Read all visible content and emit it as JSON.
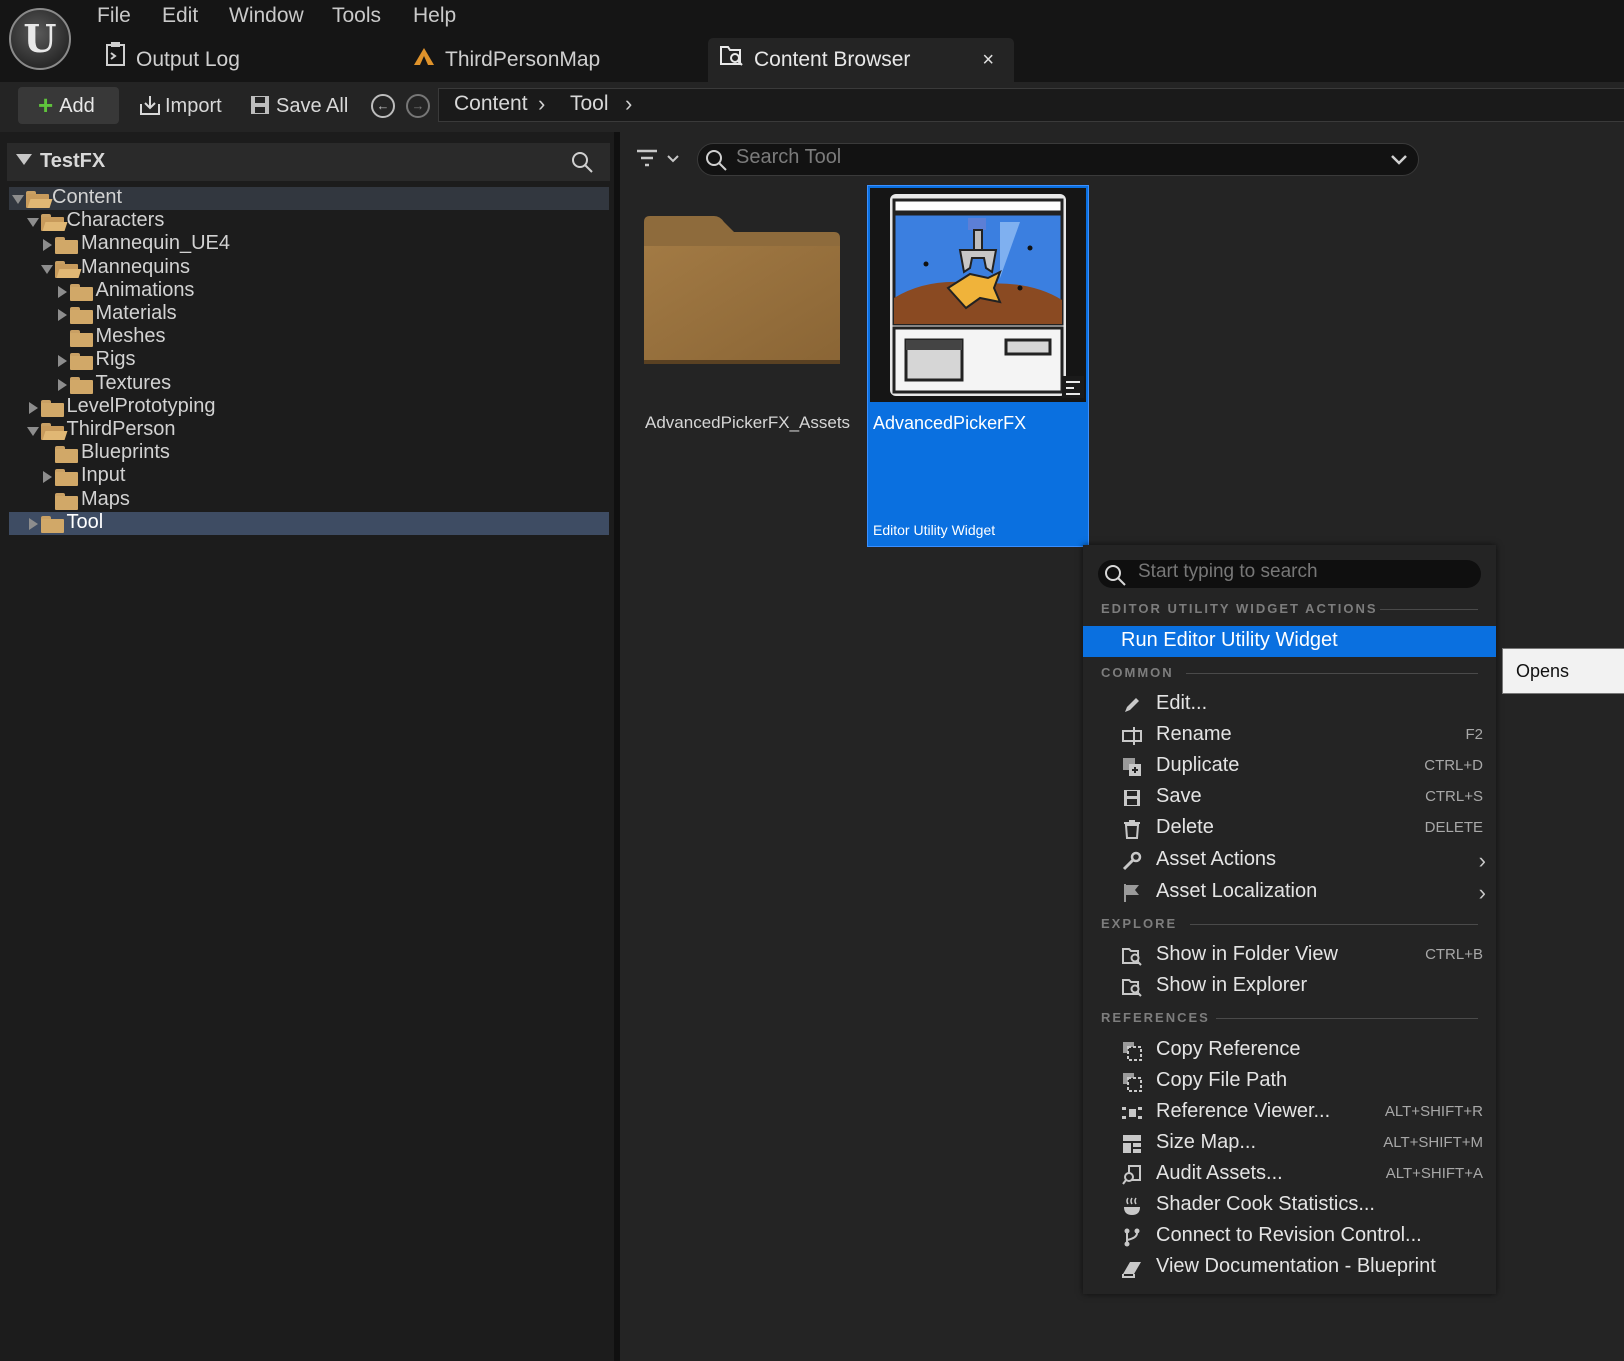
{
  "menubar": {
    "items": [
      "File",
      "Edit",
      "Window",
      "Tools",
      "Help"
    ]
  },
  "tabs": [
    {
      "label": "Output Log",
      "icon": "output-log-icon"
    },
    {
      "label": "ThirdPersonMap",
      "icon": "level-icon"
    },
    {
      "label": "Content Browser",
      "icon": "content-browser-icon",
      "active": true,
      "close": "×"
    }
  ],
  "toolbar": {
    "add_label": "Add",
    "import_label": "Import",
    "save_all_label": "Save All"
  },
  "breadcrumb": {
    "items": [
      "Content",
      "Tool"
    ]
  },
  "tree": {
    "header": "TestFX",
    "items": [
      {
        "label": "Content",
        "depth": 0,
        "expanded": true
      },
      {
        "label": "Characters",
        "depth": 1,
        "expanded": true
      },
      {
        "label": "Mannequin_UE4",
        "depth": 2,
        "expanded": false
      },
      {
        "label": "Mannequins",
        "depth": 2,
        "expanded": true
      },
      {
        "label": "Animations",
        "depth": 3,
        "expanded": false
      },
      {
        "label": "Materials",
        "depth": 3,
        "expanded": false
      },
      {
        "label": "Meshes",
        "depth": 3
      },
      {
        "label": "Rigs",
        "depth": 3,
        "expanded": false
      },
      {
        "label": "Textures",
        "depth": 3,
        "expanded": false
      },
      {
        "label": "LevelPrototyping",
        "depth": 1,
        "expanded": false
      },
      {
        "label": "ThirdPerson",
        "depth": 1,
        "expanded": true
      },
      {
        "label": "Blueprints",
        "depth": 2
      },
      {
        "label": "Input",
        "depth": 2,
        "expanded": false
      },
      {
        "label": "Maps",
        "depth": 2
      },
      {
        "label": "Tool",
        "depth": 1,
        "expanded": false,
        "selected": true
      }
    ]
  },
  "search": {
    "placeholder": "Search Tool"
  },
  "assets": [
    {
      "name": "AdvancedPickerFX_Assets",
      "kind": "folder"
    },
    {
      "name": "AdvancedPickerFX",
      "type": "Editor Utility Widget",
      "selected": true
    }
  ],
  "context_menu": {
    "search_placeholder": "Start typing to search",
    "sections": {
      "editor_utility": "EDITOR UTILITY WIDGET ACTIONS",
      "common": "COMMON",
      "explore": "EXPLORE",
      "references": "REFERENCES"
    },
    "items": {
      "run": {
        "label": "Run Editor Utility Widget"
      },
      "edit": {
        "label": "Edit..."
      },
      "rename": {
        "label": "Rename",
        "shortcut": "F2"
      },
      "duplicate": {
        "label": "Duplicate",
        "shortcut": "CTRL+D"
      },
      "save": {
        "label": "Save",
        "shortcut": "CTRL+S"
      },
      "delete": {
        "label": "Delete",
        "shortcut": "DELETE"
      },
      "asset_actions": {
        "label": "Asset Actions"
      },
      "asset_localization": {
        "label": "Asset Localization"
      },
      "show_folder": {
        "label": "Show in Folder View",
        "shortcut": "CTRL+B"
      },
      "show_explorer": {
        "label": "Show in Explorer"
      },
      "copy_reference": {
        "label": "Copy Reference"
      },
      "copy_file_path": {
        "label": "Copy File Path"
      },
      "reference_viewer": {
        "label": "Reference Viewer...",
        "shortcut": "ALT+SHIFT+R"
      },
      "size_map": {
        "label": "Size Map...",
        "shortcut": "ALT+SHIFT+M"
      },
      "audit_assets": {
        "label": "Audit Assets...",
        "shortcut": "ALT+SHIFT+A"
      },
      "shader_cook": {
        "label": "Shader Cook Statistics..."
      },
      "revision_control": {
        "label": "Connect to Revision Control..."
      },
      "view_docs": {
        "label": "View Documentation - Blueprint"
      }
    }
  },
  "tooltip": {
    "text": "Opens"
  },
  "colors": {
    "accent": "#0a70e0",
    "folder": "#d1a868",
    "add_green": "#5fc23c"
  }
}
